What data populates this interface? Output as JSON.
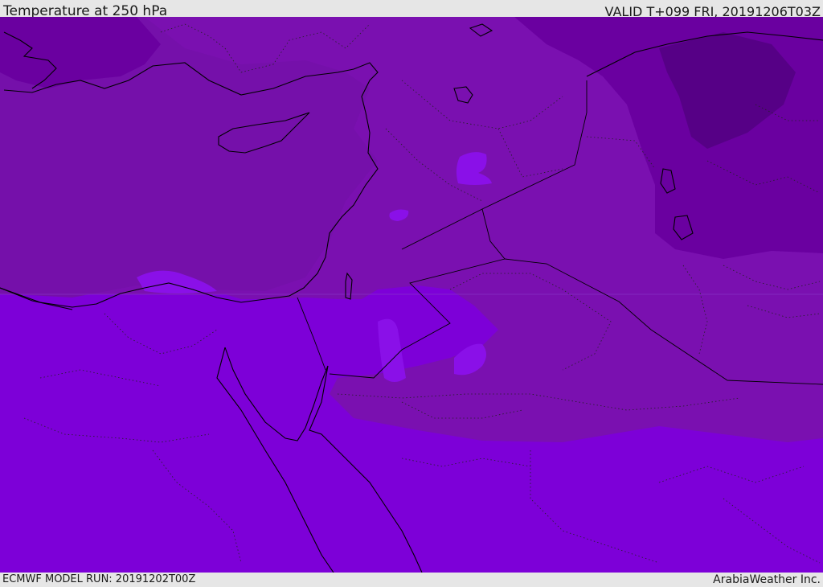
{
  "header": {
    "title": "Temperature at 250 hPa",
    "valid_time": "VALID T+099 FRI, 20191206T03Z"
  },
  "footer": {
    "model_run": "ECMWF MODEL RUN: 20191202T00Z",
    "credit": "ArabiaWeather Inc."
  },
  "map": {
    "colors": {
      "coldest": "#560086",
      "colder": "#6a00a0",
      "cold": "#7a10b0",
      "mid": "#7d00d8",
      "warm_patch": "#8a10e8",
      "coastline": "#000000"
    }
  }
}
